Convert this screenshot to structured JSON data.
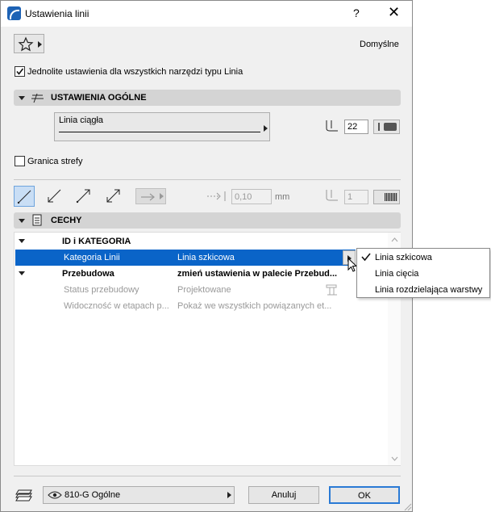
{
  "window": {
    "title": "Ustawienia linii",
    "help": "?",
    "close": "✕"
  },
  "favorites": {
    "preset": "Domyślne"
  },
  "uniform_settings": {
    "label": "Jednolite ustawienia dla wszystkich narzędzi typu Linia",
    "checked": true
  },
  "general": {
    "title": "USTAWIENIA OGÓLNE",
    "line_type": "Linia ciągła",
    "pen_number": "22"
  },
  "zone_boundary": {
    "label": "Granica strefy",
    "checked": false
  },
  "geometry": {
    "offset_value": "0,10",
    "unit": "mm",
    "pen2_number": "1"
  },
  "properties": {
    "title": "CECHY",
    "rows": [
      {
        "name": "ID i KATEGORIA",
        "value": "",
        "kind": "group"
      },
      {
        "name": "Kategoria Linii",
        "value": "Linia szkicowa",
        "kind": "selected"
      },
      {
        "name": "Przebudowa",
        "value": "zmień ustawienia w palecie Przebud...",
        "kind": "group"
      },
      {
        "name": "Status przebudowy",
        "value": "Projektowane",
        "kind": "dim"
      },
      {
        "name": "Widoczność w etapach p...",
        "value": "Pokaż we wszystkich powiązanych et...",
        "kind": "dim"
      }
    ]
  },
  "popup_menu": {
    "items": [
      {
        "label": "Linia szkicowa",
        "checked": true
      },
      {
        "label": "Linia cięcia",
        "checked": false
      },
      {
        "label": "Linia rozdzielająca warstwy",
        "checked": false
      }
    ]
  },
  "footer": {
    "layer": "810-G Ogólne",
    "cancel": "Anuluj",
    "ok": "OK"
  },
  "colors": {
    "selection": "#0a64c8",
    "accent": "#1e63b5",
    "ok_border": "#2a7ad5"
  }
}
